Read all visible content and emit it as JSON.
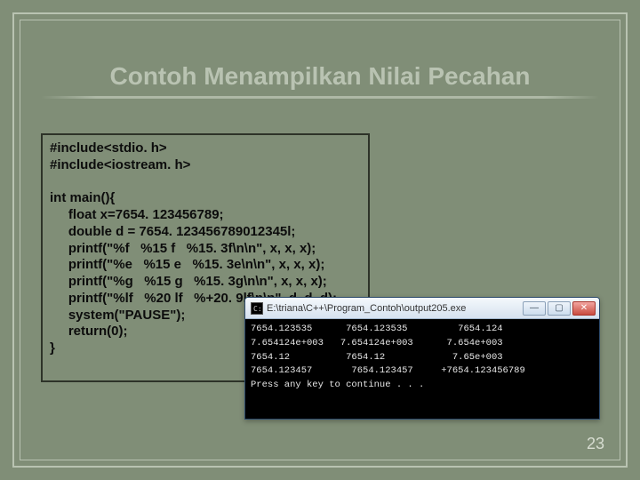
{
  "title": "Contoh Menampilkan Nilai Pecahan",
  "code": "#include<stdio. h>\n#include<iostream. h>\n\nint main(){\n     float x=7654. 123456789;\n     double d = 7654. 123456789012345l;\n     printf(\"%f   %15 f   %15. 3f\\n\\n\", x, x, x);\n     printf(\"%e   %15 e   %15. 3e\\n\\n\", x, x, x);\n     printf(\"%g   %15 g   %15. 3g\\n\\n\", x, x, x);\n     printf(\"%lf   %20 lf   %+20. 9lf\\n\\n\", d, d, d);\n     system(\"PAUSE\");\n     return(0);\n}",
  "console": {
    "title": "E:\\triana\\C++\\Program_Contoh\\output205.exe",
    "output": "7654.123535      7654.123535         7654.124\n7.654124e+003   7.654124e+003      7.654e+003\n7654.12          7654.12            7.65e+003\n7654.123457       7654.123457     +7654.123456789\nPress any key to continue . . ."
  },
  "pageNumber": "23",
  "buttons": {
    "min": "—",
    "max": "▢",
    "close": "✕"
  }
}
